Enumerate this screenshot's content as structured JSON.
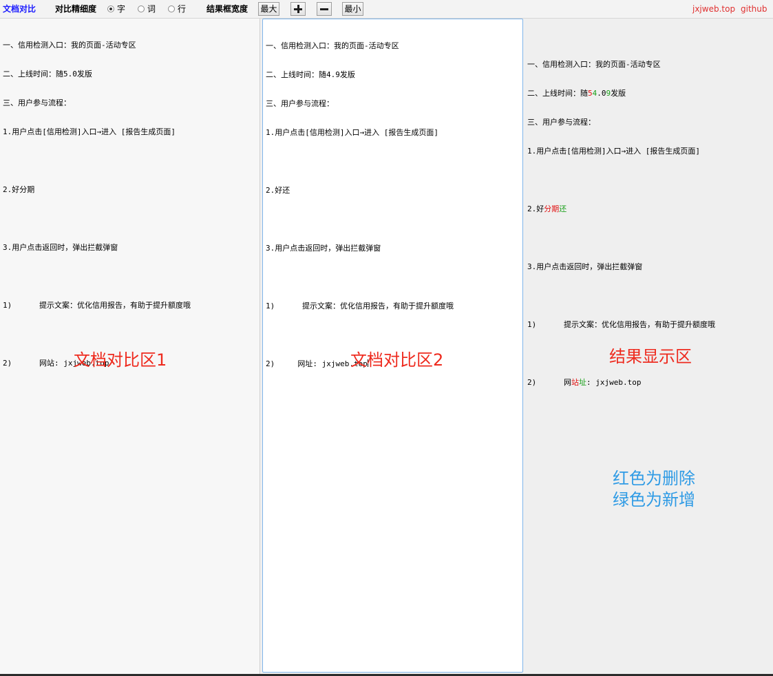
{
  "toolbar": {
    "app_title": "文档对比",
    "precision_label": "对比精细度",
    "options": [
      "字",
      "词",
      "行"
    ],
    "selected_option": "字",
    "width_label": "结果框宽度",
    "max_button": "最大",
    "min_button": "最小",
    "links": [
      "jxjweb.top",
      "github"
    ]
  },
  "pane1": {
    "lines": [
      "一、信用检测入口：我的页面-活动专区",
      "二、上线时间：随5.0发版",
      "三、用户参与流程：",
      "1.用户点击[信用检测]入口→进入 [报告生成页面]",
      "",
      "2.好分期",
      "",
      "3.用户点击返回时，弹出拦截弹窗",
      "",
      "1)      提示文案：优化信用报告，有助于提升额度哦",
      "",
      "2)      网站: jxjweb.top"
    ],
    "overlay": "文档对比区1"
  },
  "pane2": {
    "lines": [
      "一、信用检测入口：我的页面-活动专区",
      "二、上线时间：随4.9发版",
      "三、用户参与流程：",
      "1.用户点击[信用检测]入口→进入 [报告生成页面]",
      "",
      "2.好还",
      "",
      "3.用户点击返回时，弹出拦截弹窗",
      "",
      "1)      提示文案：优化信用报告，有助于提升额度哦",
      "",
      "2)     网址: jxjweb.top"
    ],
    "overlay": "文档对比区2"
  },
  "result": {
    "line1": "一、信用检测入口：我的页面-活动专区",
    "line2_pre": "二、上线时间：随",
    "line2_del1": "5",
    "line2_add1": "4",
    "line2_mid": ".0",
    "line2_add2": "9",
    "line2_post": "发版",
    "line3": "三、用户参与流程：",
    "line4": "1.用户点击[信用检测]入口→进入 [报告生成页面]",
    "line6_pre": "2.好",
    "line6_del": "分期",
    "line6_add": "还",
    "line8": "3.用户点击返回时，弹出拦截弹窗",
    "line10": "1)      提示文案：优化信用报告，有助于提升额度哦",
    "line12_pre": "2)      ",
    "line12_mid": "网",
    "line12_del": "站",
    "line12_add": "址",
    "line12_post": ": jxjweb.top",
    "overlay": "结果显示区"
  },
  "legend": {
    "line1": "红色为删除",
    "line2": "绿色为新增"
  },
  "colors": {
    "deleted": "#e01010",
    "added": "#1aa01a",
    "overlay_label": "#ee2a1e",
    "legend": "#2f9be5",
    "title": "#1a1aff"
  }
}
